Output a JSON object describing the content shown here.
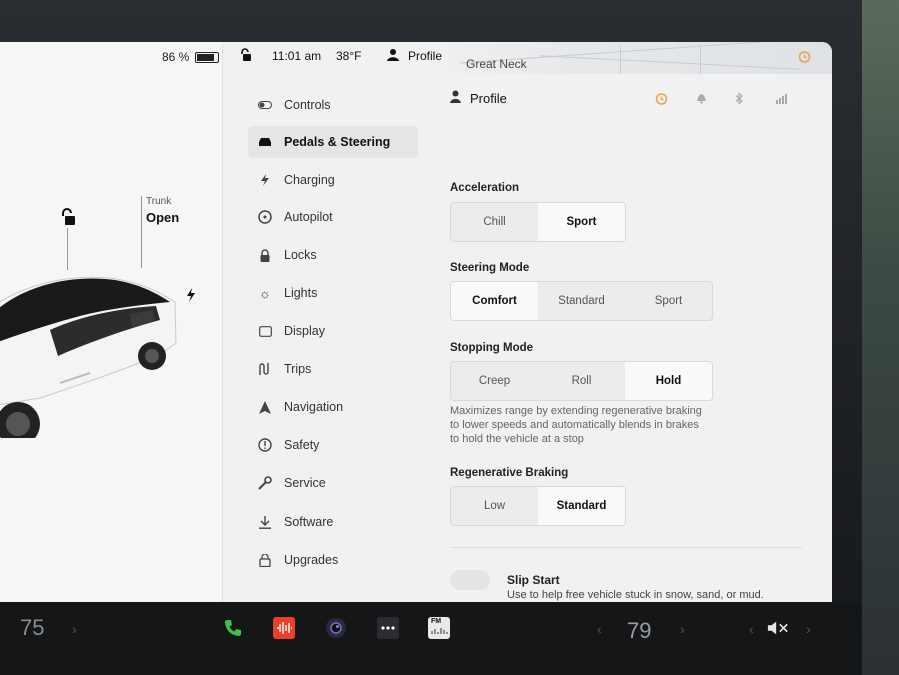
{
  "status_bar": {
    "battery": "86 %",
    "battery_fraction": 0.86,
    "time": "11:01 am",
    "temperature": "38°F",
    "profile": "Profile",
    "map_label": "Great Neck"
  },
  "car_panel": {
    "trunk_label": "Trunk",
    "trunk_state": "Open"
  },
  "menu": {
    "items": [
      {
        "label": "Controls",
        "icon": "toggle-icon"
      },
      {
        "label": "Pedals & Steering",
        "icon": "car-icon",
        "active": true
      },
      {
        "label": "Charging",
        "icon": "bolt-icon"
      },
      {
        "label": "Autopilot",
        "icon": "steering-wheel-icon"
      },
      {
        "label": "Locks",
        "icon": "lock-icon"
      },
      {
        "label": "Lights",
        "icon": "sun-icon"
      },
      {
        "label": "Display",
        "icon": "display-icon"
      },
      {
        "label": "Trips",
        "icon": "trips-icon"
      },
      {
        "label": "Navigation",
        "icon": "navigation-icon"
      },
      {
        "label": "Safety",
        "icon": "alert-icon"
      },
      {
        "label": "Service",
        "icon": "wrench-icon"
      },
      {
        "label": "Software",
        "icon": "download-icon"
      },
      {
        "label": "Upgrades",
        "icon": "bag-icon"
      }
    ]
  },
  "content": {
    "profile_header": "Profile",
    "acceleration": {
      "label": "Acceleration",
      "options": [
        "Chill",
        "Sport"
      ],
      "selected": "Sport"
    },
    "steering": {
      "label": "Steering Mode",
      "options": [
        "Comfort",
        "Standard",
        "Sport"
      ],
      "selected": "Comfort"
    },
    "stopping": {
      "label": "Stopping Mode",
      "options": [
        "Creep",
        "Roll",
        "Hold"
      ],
      "selected": "Hold",
      "description": "Maximizes range by extending regenerative braking to lower speeds and automatically blends in brakes to hold the vehicle at a stop"
    },
    "regen": {
      "label": "Regenerative Braking",
      "options": [
        "Low",
        "Standard"
      ],
      "selected": "Standard"
    },
    "slip_start": {
      "title": "Slip Start",
      "description": "Use to help free vehicle stuck in snow, sand, or mud."
    }
  },
  "taskbar": {
    "driver_temp": "75",
    "passenger_temp": "79",
    "radio_label": "FM"
  },
  "colors": {
    "alarm_orange": "#e8a24a",
    "phone_green": "#3fbf4d",
    "tunein_red": "#e8402a"
  }
}
